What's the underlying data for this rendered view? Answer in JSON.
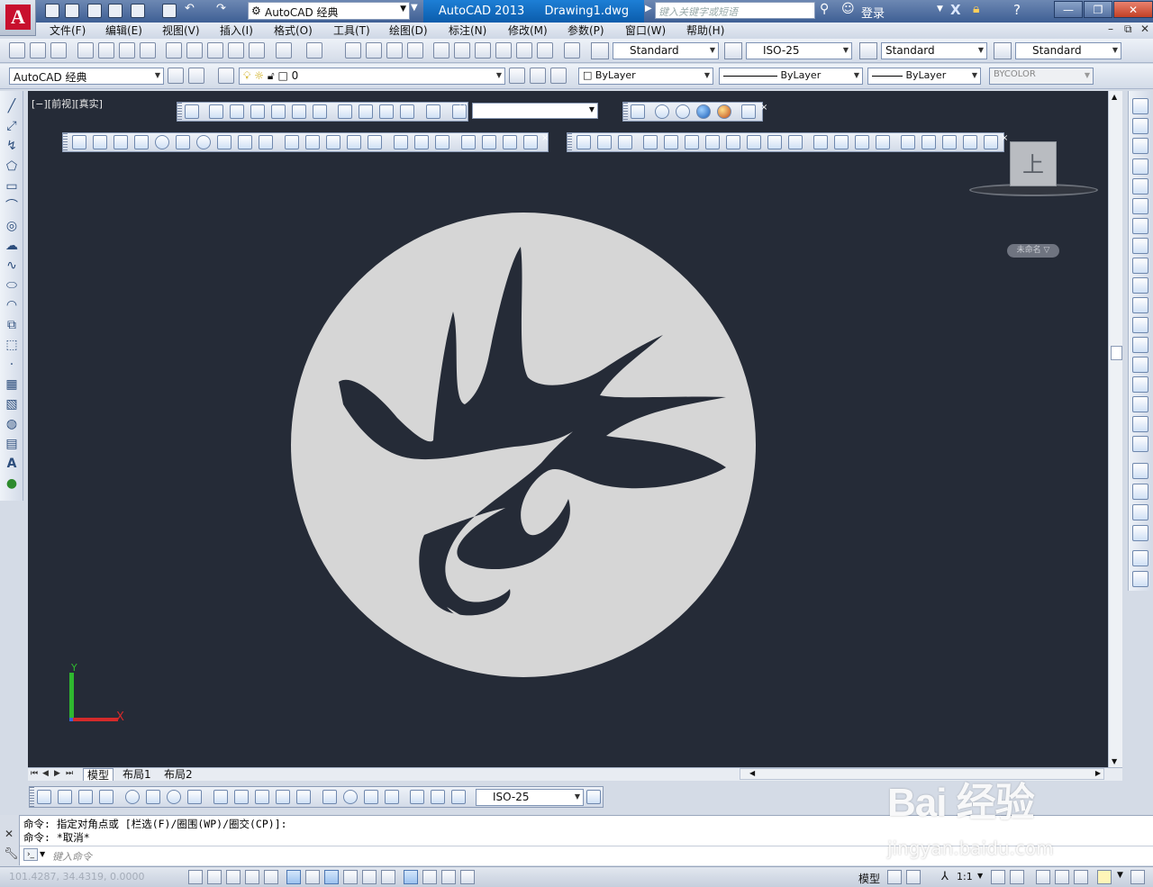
{
  "window": {
    "app_name": "AutoCAD 2013",
    "doc_name": "Drawing1.dwg",
    "workspace": "AutoCAD 经典",
    "search_placeholder": "键入关键字或短语",
    "login_label": "登录",
    "minimize": "—",
    "restore": "❐",
    "close": "✕"
  },
  "menu": [
    "文件(F)",
    "编辑(E)",
    "视图(V)",
    "插入(I)",
    "格式(O)",
    "工具(T)",
    "绘图(D)",
    "标注(N)",
    "修改(M)",
    "参数(P)",
    "窗口(W)",
    "帮助(H)"
  ],
  "styles": {
    "text_style": "Standard",
    "dim_style": "ISO-25",
    "table_style": "Standard",
    "mleader_style": "Standard"
  },
  "layers": {
    "workspace": "AutoCAD 经典",
    "layer_name": "0",
    "color": "ByLayer",
    "linetype": "ByLayer",
    "lineweight": "ByLayer",
    "plotstyle": "BYCOLOR"
  },
  "viewport": {
    "label": "[−][前视][真实]",
    "viewcube_face": "上",
    "wcs_label": "未命名 ▽",
    "background": "#252b37",
    "drawing_fill": "#d6d6d6",
    "ucs_x": "X",
    "ucs_y": "Y"
  },
  "layout_tabs": [
    "模型",
    "布局1",
    "布局2"
  ],
  "dim_toolbar": {
    "dim_style": "ISO-25"
  },
  "command": {
    "line1": "命令: 指定对角点或 [栏选(F)/圈围(WP)/圈交(CP)]:",
    "line2": "命令: *取消*",
    "input_placeholder": "键入命令"
  },
  "status": {
    "coords": "101.4287, 34.4319, 0.0000",
    "model_label": "模型",
    "annotation_scale": "1:1"
  },
  "watermark": {
    "main": "Bai 经验",
    "sub": "jingyan.baidu.com"
  }
}
